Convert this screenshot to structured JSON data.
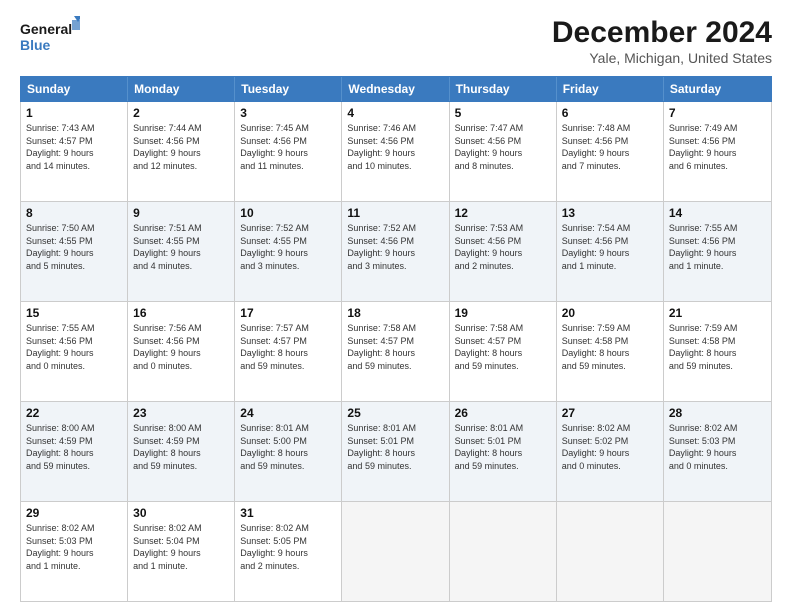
{
  "logo": {
    "line1": "General",
    "line2": "Blue"
  },
  "title": "December 2024",
  "subtitle": "Yale, Michigan, United States",
  "days_of_week": [
    "Sunday",
    "Monday",
    "Tuesday",
    "Wednesday",
    "Thursday",
    "Friday",
    "Saturday"
  ],
  "weeks": [
    [
      {
        "day": "1",
        "lines": [
          "Sunrise: 7:43 AM",
          "Sunset: 4:57 PM",
          "Daylight: 9 hours",
          "and 14 minutes."
        ]
      },
      {
        "day": "2",
        "lines": [
          "Sunrise: 7:44 AM",
          "Sunset: 4:56 PM",
          "Daylight: 9 hours",
          "and 12 minutes."
        ]
      },
      {
        "day": "3",
        "lines": [
          "Sunrise: 7:45 AM",
          "Sunset: 4:56 PM",
          "Daylight: 9 hours",
          "and 11 minutes."
        ]
      },
      {
        "day": "4",
        "lines": [
          "Sunrise: 7:46 AM",
          "Sunset: 4:56 PM",
          "Daylight: 9 hours",
          "and 10 minutes."
        ]
      },
      {
        "day": "5",
        "lines": [
          "Sunrise: 7:47 AM",
          "Sunset: 4:56 PM",
          "Daylight: 9 hours",
          "and 8 minutes."
        ]
      },
      {
        "day": "6",
        "lines": [
          "Sunrise: 7:48 AM",
          "Sunset: 4:56 PM",
          "Daylight: 9 hours",
          "and 7 minutes."
        ]
      },
      {
        "day": "7",
        "lines": [
          "Sunrise: 7:49 AM",
          "Sunset: 4:56 PM",
          "Daylight: 9 hours",
          "and 6 minutes."
        ]
      }
    ],
    [
      {
        "day": "8",
        "lines": [
          "Sunrise: 7:50 AM",
          "Sunset: 4:55 PM",
          "Daylight: 9 hours",
          "and 5 minutes."
        ]
      },
      {
        "day": "9",
        "lines": [
          "Sunrise: 7:51 AM",
          "Sunset: 4:55 PM",
          "Daylight: 9 hours",
          "and 4 minutes."
        ]
      },
      {
        "day": "10",
        "lines": [
          "Sunrise: 7:52 AM",
          "Sunset: 4:55 PM",
          "Daylight: 9 hours",
          "and 3 minutes."
        ]
      },
      {
        "day": "11",
        "lines": [
          "Sunrise: 7:52 AM",
          "Sunset: 4:56 PM",
          "Daylight: 9 hours",
          "and 3 minutes."
        ]
      },
      {
        "day": "12",
        "lines": [
          "Sunrise: 7:53 AM",
          "Sunset: 4:56 PM",
          "Daylight: 9 hours",
          "and 2 minutes."
        ]
      },
      {
        "day": "13",
        "lines": [
          "Sunrise: 7:54 AM",
          "Sunset: 4:56 PM",
          "Daylight: 9 hours",
          "and 1 minute."
        ]
      },
      {
        "day": "14",
        "lines": [
          "Sunrise: 7:55 AM",
          "Sunset: 4:56 PM",
          "Daylight: 9 hours",
          "and 1 minute."
        ]
      }
    ],
    [
      {
        "day": "15",
        "lines": [
          "Sunrise: 7:55 AM",
          "Sunset: 4:56 PM",
          "Daylight: 9 hours",
          "and 0 minutes."
        ]
      },
      {
        "day": "16",
        "lines": [
          "Sunrise: 7:56 AM",
          "Sunset: 4:56 PM",
          "Daylight: 9 hours",
          "and 0 minutes."
        ]
      },
      {
        "day": "17",
        "lines": [
          "Sunrise: 7:57 AM",
          "Sunset: 4:57 PM",
          "Daylight: 8 hours",
          "and 59 minutes."
        ]
      },
      {
        "day": "18",
        "lines": [
          "Sunrise: 7:58 AM",
          "Sunset: 4:57 PM",
          "Daylight: 8 hours",
          "and 59 minutes."
        ]
      },
      {
        "day": "19",
        "lines": [
          "Sunrise: 7:58 AM",
          "Sunset: 4:57 PM",
          "Daylight: 8 hours",
          "and 59 minutes."
        ]
      },
      {
        "day": "20",
        "lines": [
          "Sunrise: 7:59 AM",
          "Sunset: 4:58 PM",
          "Daylight: 8 hours",
          "and 59 minutes."
        ]
      },
      {
        "day": "21",
        "lines": [
          "Sunrise: 7:59 AM",
          "Sunset: 4:58 PM",
          "Daylight: 8 hours",
          "and 59 minutes."
        ]
      }
    ],
    [
      {
        "day": "22",
        "lines": [
          "Sunrise: 8:00 AM",
          "Sunset: 4:59 PM",
          "Daylight: 8 hours",
          "and 59 minutes."
        ]
      },
      {
        "day": "23",
        "lines": [
          "Sunrise: 8:00 AM",
          "Sunset: 4:59 PM",
          "Daylight: 8 hours",
          "and 59 minutes."
        ]
      },
      {
        "day": "24",
        "lines": [
          "Sunrise: 8:01 AM",
          "Sunset: 5:00 PM",
          "Daylight: 8 hours",
          "and 59 minutes."
        ]
      },
      {
        "day": "25",
        "lines": [
          "Sunrise: 8:01 AM",
          "Sunset: 5:01 PM",
          "Daylight: 8 hours",
          "and 59 minutes."
        ]
      },
      {
        "day": "26",
        "lines": [
          "Sunrise: 8:01 AM",
          "Sunset: 5:01 PM",
          "Daylight: 8 hours",
          "and 59 minutes."
        ]
      },
      {
        "day": "27",
        "lines": [
          "Sunrise: 8:02 AM",
          "Sunset: 5:02 PM",
          "Daylight: 9 hours",
          "and 0 minutes."
        ]
      },
      {
        "day": "28",
        "lines": [
          "Sunrise: 8:02 AM",
          "Sunset: 5:03 PM",
          "Daylight: 9 hours",
          "and 0 minutes."
        ]
      }
    ],
    [
      {
        "day": "29",
        "lines": [
          "Sunrise: 8:02 AM",
          "Sunset: 5:03 PM",
          "Daylight: 9 hours",
          "and 1 minute."
        ]
      },
      {
        "day": "30",
        "lines": [
          "Sunrise: 8:02 AM",
          "Sunset: 5:04 PM",
          "Daylight: 9 hours",
          "and 1 minute."
        ]
      },
      {
        "day": "31",
        "lines": [
          "Sunrise: 8:02 AM",
          "Sunset: 5:05 PM",
          "Daylight: 9 hours",
          "and 2 minutes."
        ]
      },
      {
        "day": "",
        "lines": []
      },
      {
        "day": "",
        "lines": []
      },
      {
        "day": "",
        "lines": []
      },
      {
        "day": "",
        "lines": []
      }
    ]
  ]
}
